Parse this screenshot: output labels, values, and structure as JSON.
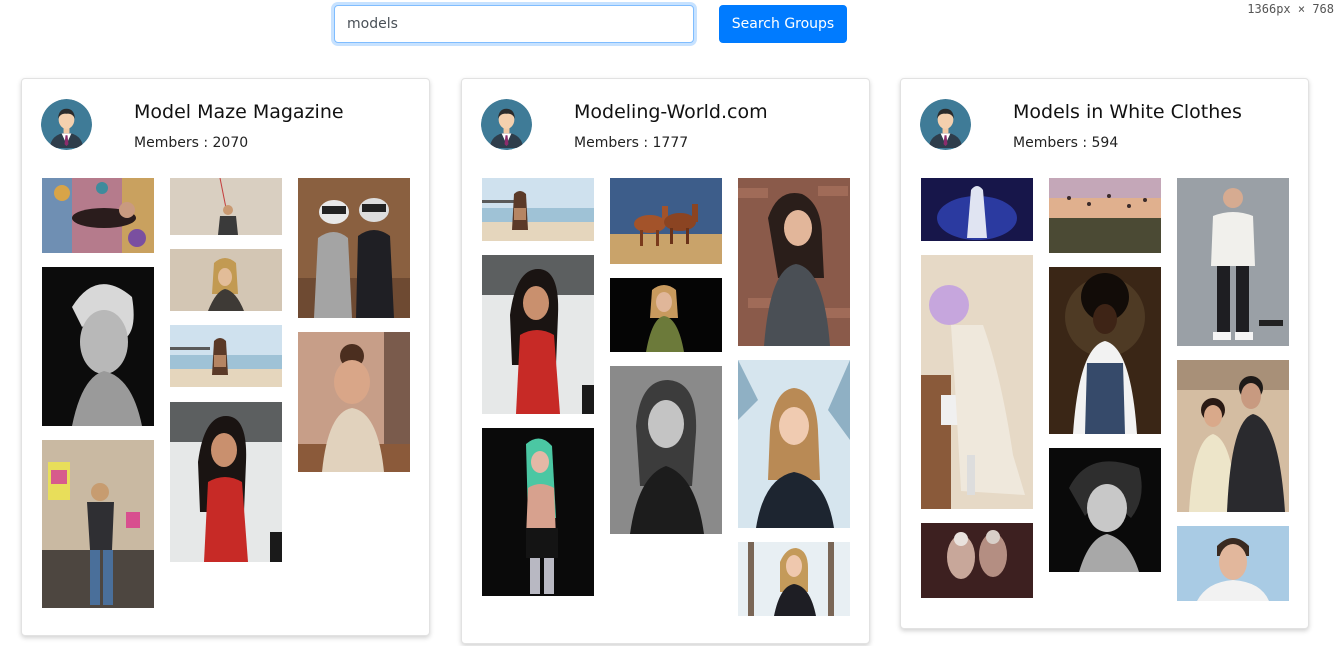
{
  "search": {
    "value": "models",
    "button_label": "Search Groups"
  },
  "viewport_readout": "1366px × 768",
  "groups": [
    {
      "name": "Model Maze Magazine",
      "members_label": "Members : ",
      "members_count": "2070",
      "photos": [
        "model-on-patterned-blanket-photo",
        "black-and-white-blonde-portrait-photo",
        "model-holding-sign-on-couch-photo",
        "model-with-balloon-string-photo",
        "blonde-model-beige-backdrop-photo",
        "model-on-beach-pier-photo",
        "model-in-red-top-photo",
        "two-models-in-ski-goggles-photo",
        "smiling-model-in-cafe-photo"
      ]
    },
    {
      "name": "Modeling-World.com",
      "members_label": "Members : ",
      "members_count": "1777",
      "photos": [
        "model-on-beach-pier-photo",
        "model-in-red-top-photo",
        "model-with-green-hair-photo",
        "two-horses-photo",
        "model-in-green-top-photo",
        "black-and-white-curly-hair-photo",
        "model-against-brick-wall-photo",
        "model-in-snow-photo",
        "model-in-snowy-forest-photo"
      ]
    },
    {
      "name": "Models in White Clothes",
      "members_label": "Members : ",
      "members_count": "594",
      "photos": [
        "model-in-white-dress-blue-light-photo",
        "model-with-lilac-hair-photo",
        "two-dancers-photo",
        "hot-air-balloons-landscape-photo",
        "model-in-overalls-photo",
        "black-and-white-curly-man-photo",
        "man-in-white-sweater-photo",
        "couple-portrait-photo",
        "man-portrait-blue-sky-photo"
      ]
    }
  ],
  "colors": {
    "accent": "#007bff",
    "focus_border": "#80bdff",
    "card_border": "#e2e2e2"
  }
}
